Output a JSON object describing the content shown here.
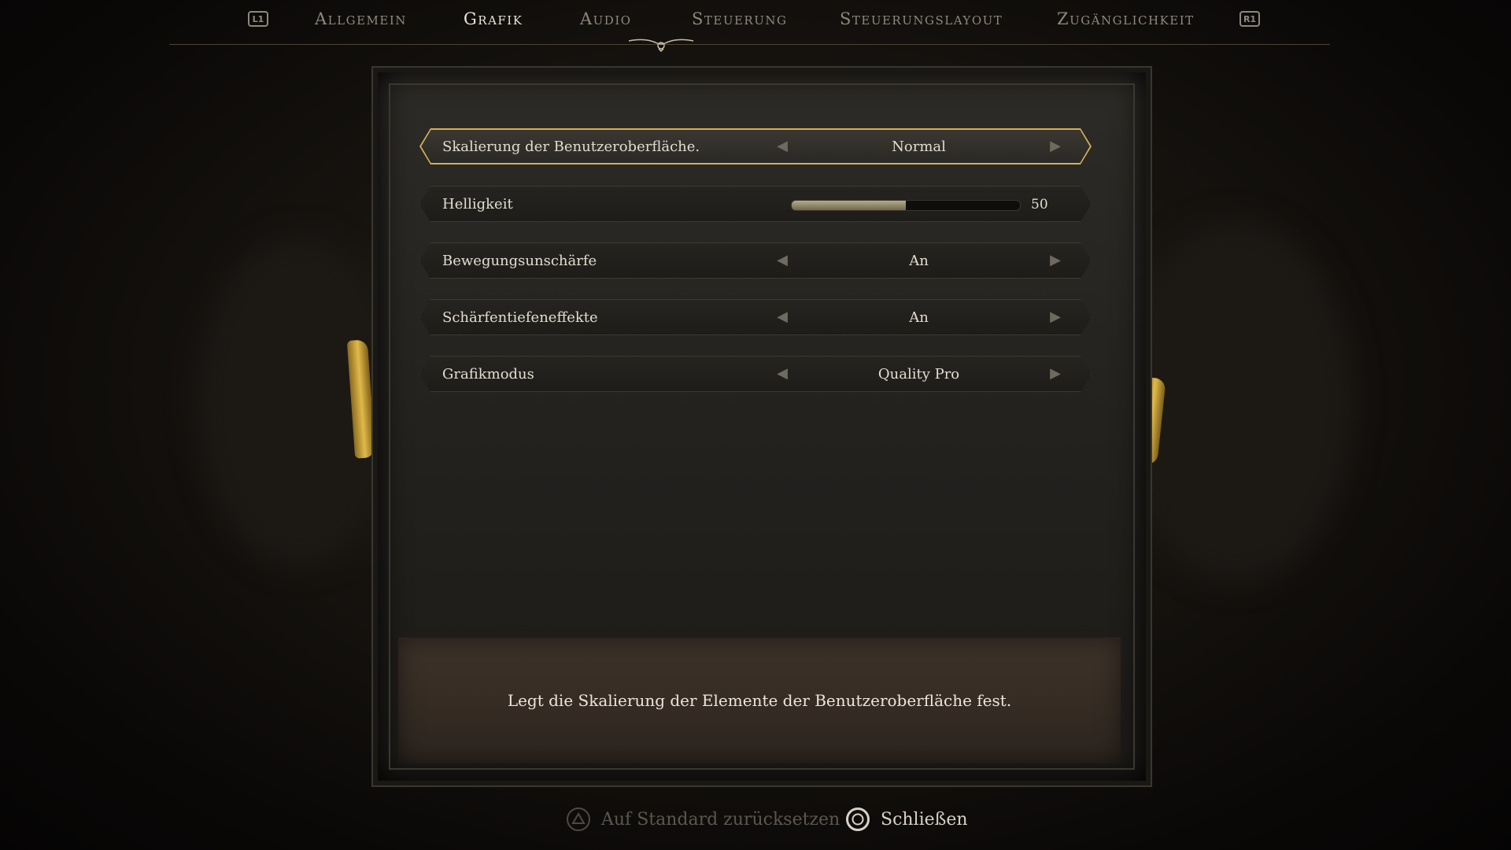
{
  "tabs": {
    "left_shoulder": "L1",
    "right_shoulder": "R1",
    "items": [
      {
        "label": "Allgemein"
      },
      {
        "label": "Grafik"
      },
      {
        "label": "Audio"
      },
      {
        "label": "Steuerung"
      },
      {
        "label": "Steuerungslayout"
      },
      {
        "label": "Zugänglichkeit"
      }
    ],
    "active_index": 1
  },
  "settings": [
    {
      "label": "Skalierung der Benutzeroberfläche.",
      "value": "Normal"
    },
    {
      "label": "Helligkeit",
      "value": "50",
      "level": 0.5
    },
    {
      "label": "Bewegungsunschärfe",
      "value": "An"
    },
    {
      "label": "Schärfentiefeneffekte",
      "value": "An"
    },
    {
      "label": "Grafikmodus",
      "value": "Quality Pro"
    }
  ],
  "description": "Legt die Skalierung der Elemente der Benutzeroberfläche fest.",
  "prompts": {
    "reset": "Auf Standard zurücksetzen",
    "close": "Schließen"
  },
  "icons": {
    "triangle": "triangle-button-icon",
    "circle": "circle-button-icon"
  },
  "colors": {
    "accent_gold": "#d4b056",
    "text": "#e2ddd0"
  }
}
